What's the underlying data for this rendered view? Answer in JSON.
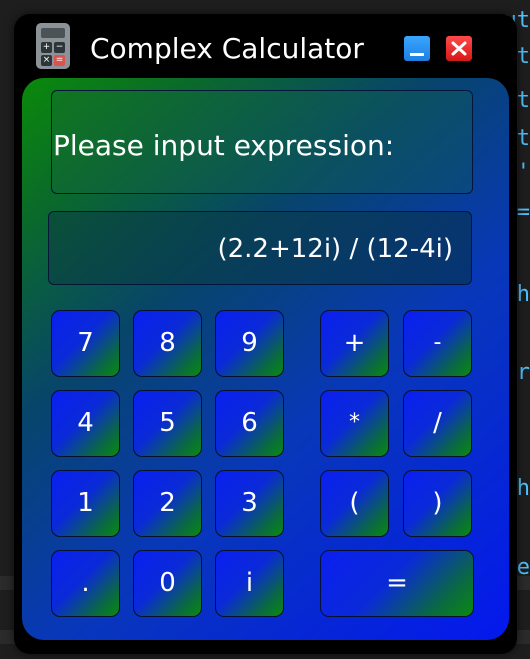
{
  "window": {
    "title": "Complex Calculator"
  },
  "display": {
    "prompt": "Please input expression:",
    "expression": "(2.2+12i) / (12-4i)"
  },
  "keys": {
    "k7": "7",
    "k8": "8",
    "k9": "9",
    "plus": "+",
    "minus": "-",
    "k4": "4",
    "k5": "5",
    "k6": "6",
    "multiply": "*",
    "divide": "/",
    "k1": "1",
    "k2": "2",
    "k3": "3",
    "lparen": "(",
    "rparen": ")",
    "dot": ".",
    "k0": "0",
    "imag": "i",
    "equals": "="
  },
  "colors": {
    "minimize_button": "#2f95f5",
    "close_button": "#e82a2a",
    "panel_gradient_start": "#0a8a0a",
    "panel_gradient_end": "#0418ee",
    "key_gradient_start": "#0a1ff0",
    "key_gradient_end": "#0a8a10"
  },
  "icons": {
    "app": "calculator-icon",
    "minimize": "minimize-icon",
    "close": "close-icon"
  }
}
